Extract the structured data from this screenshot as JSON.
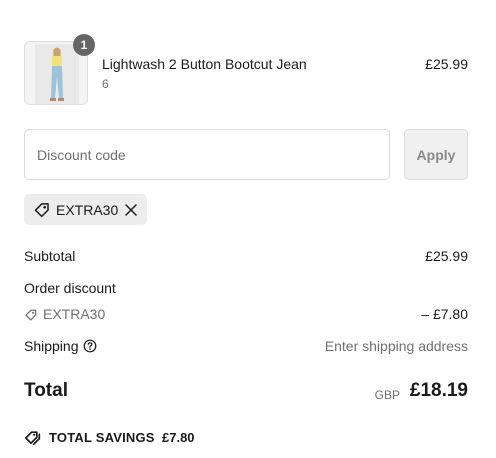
{
  "line_item": {
    "name": "Lightwash 2 Button Bootcut Jean",
    "variant": "6",
    "price": "£25.99",
    "quantity": "1",
    "image_icon": "jeans-product-thumbnail"
  },
  "discount": {
    "placeholder": "Discount code",
    "value": "",
    "apply_label": "Apply",
    "applied_code": "EXTRA30"
  },
  "summary": {
    "subtotal_label": "Subtotal",
    "subtotal_value": "£25.99",
    "order_discount_label": "Order discount",
    "order_discount_code": "EXTRA30",
    "order_discount_value": "– £7.80",
    "shipping_label": "Shipping",
    "shipping_value": "Enter shipping address",
    "total_label": "Total",
    "currency": "GBP",
    "total_value": "£18.19",
    "savings_label": "TOTAL SAVINGS",
    "savings_value": "£7.80"
  },
  "colors": {
    "text": "#1a1a1a",
    "muted": "#707070",
    "badge": "#666666",
    "chip_bg": "#ededed"
  }
}
